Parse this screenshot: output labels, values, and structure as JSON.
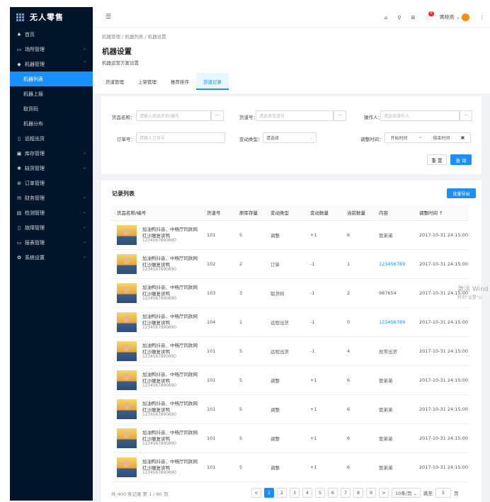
{
  "brand": "无人零售",
  "sidebar": {
    "items": [
      {
        "label": "首页",
        "icon": "home-icon",
        "glyph": "♠",
        "arrow": ""
      },
      {
        "label": "场所管理",
        "icon": "store-icon",
        "glyph": "▭",
        "arrow": "⌄"
      },
      {
        "label": "机器管理",
        "icon": "machine-icon",
        "glyph": "◆",
        "arrow": "⌃"
      }
    ],
    "subitems": [
      "机器列表",
      "机器上报",
      "取货码",
      "机器分布"
    ],
    "items2": [
      {
        "label": "远程出货",
        "icon": "remote-icon",
        "glyph": "▯",
        "arrow": ""
      },
      {
        "label": "库存管理",
        "icon": "stock-icon",
        "glyph": "▣",
        "arrow": "⌄"
      },
      {
        "label": "缺货管理",
        "icon": "shortage-icon",
        "glyph": "✱",
        "arrow": "⌄"
      },
      {
        "label": "订单管理",
        "icon": "order-icon",
        "glyph": "⊛",
        "arrow": ""
      },
      {
        "label": "财务管理",
        "icon": "finance-icon",
        "glyph": "✉",
        "arrow": "⌄"
      },
      {
        "label": "检测管理",
        "icon": "check-icon",
        "glyph": "▤",
        "arrow": "⌄"
      },
      {
        "label": "故障管理",
        "icon": "fault-icon",
        "glyph": "▯",
        "arrow": "⌄"
      },
      {
        "label": "报表管理",
        "icon": "report-icon",
        "glyph": "▭",
        "arrow": "⌄"
      },
      {
        "label": "系统设置",
        "icon": "settings-icon",
        "glyph": "✿",
        "arrow": "⌄"
      }
    ]
  },
  "topbar": {
    "fold": "☰",
    "user": "黄晓燕",
    "badge": "6"
  },
  "page": {
    "breadcrumb": "机器管理 / 机器列表 / 机器设置",
    "title": "机器设置",
    "desc": "机器运营方案设置",
    "tabs": [
      "货道管理",
      "上架管理",
      "推荐排序",
      "货道记录"
    ]
  },
  "filter": {
    "name_label": "货品名称：",
    "name_ph": "请输入商品名称/编号",
    "lane_label": "货道号：",
    "lane_ph": "请选择货道号",
    "op_label": "操作人：",
    "op_ph": "请选择操作人",
    "order_label": "订单号：",
    "order_ph": "请输入订单号",
    "type_label": "变动类型：",
    "type_val": "请选择",
    "time_label": "调整时间：",
    "start": "开始时间",
    "end": "结束时间",
    "sep": "~",
    "dots": "···",
    "reset": "重 置",
    "search": "查 询"
  },
  "records": {
    "title": "记录列表",
    "export": "批量导出",
    "columns": [
      "货品名称/编号",
      "货道号",
      "原库存量",
      "变动类型",
      "变动数量",
      "当前数量",
      "内容",
      "调整时间 ↑"
    ],
    "rows": [
      {
        "name": "加油鸭抖音、中畅厅同款网红沙雕复读鸭",
        "code": "1234567890890",
        "lane": "101",
        "orig": "5",
        "type": "调整",
        "delta": "+1",
        "cur": "6",
        "content": "管弟弟",
        "link": false,
        "time": "2017-10-31  24:15:00"
      },
      {
        "name": "加油鸭抖音、中畅厅同款网红沙雕复读鸭",
        "code": "1234567890890",
        "lane": "102",
        "orig": "2",
        "type": "订单",
        "delta": "-1",
        "cur": "1",
        "content": "123456789",
        "link": true,
        "time": "2017-10-31  24:15:00"
      },
      {
        "name": "加油鸭抖音、中畅厅同款网红沙雕复读鸭",
        "code": "1234567890890",
        "lane": "103",
        "orig": "3",
        "type": "取货码",
        "delta": "-1",
        "cur": "2",
        "content": "987654",
        "link": false,
        "time": "2017-10-31  24:15:00"
      },
      {
        "name": "加油鸭抖音、中畅厅同款网红沙雕复读鸭",
        "code": "1234567890890",
        "lane": "104",
        "orig": "1",
        "type": "远程出货",
        "delta": "-1",
        "cur": "0",
        "content": "123456789",
        "link": true,
        "time": "2017-10-31  24:15:00"
      },
      {
        "name": "加油鸭抖音、中畅厅同款网红沙雕复读鸭",
        "code": "1234567890890",
        "lane": "101",
        "orig": "5",
        "type": "远程出货",
        "delta": "-1",
        "cur": "4",
        "content": "异常出货",
        "link": false,
        "time": "2017-10-31  24:15:00"
      },
      {
        "name": "加油鸭抖音、中畅厅同款网红沙雕复读鸭",
        "code": "1234567890890",
        "lane": "101",
        "orig": "5",
        "type": "调整",
        "delta": "+1",
        "cur": "6",
        "content": "管弟弟",
        "link": false,
        "time": "2017-10-31  24:15:00"
      },
      {
        "name": "加油鸭抖音、中畅厅同款网红沙雕复读鸭",
        "code": "1234567890890",
        "lane": "101",
        "orig": "5",
        "type": "调整",
        "delta": "+1",
        "cur": "6",
        "content": "管弟弟",
        "link": false,
        "time": "2017-10-31  24:15:00"
      },
      {
        "name": "加油鸭抖音、中畅厅同款网红沙雕复读鸭",
        "code": "1234567890890",
        "lane": "101",
        "orig": "5",
        "type": "调整",
        "delta": "+1",
        "cur": "6",
        "content": "管弟弟",
        "link": false,
        "time": "2017-10-31  24:15:00"
      },
      {
        "name": "加油鸭抖音、中畅厅同款网红沙雕复读鸭",
        "code": "1234567890890",
        "lane": "101",
        "orig": "5",
        "type": "调整",
        "delta": "+1",
        "cur": "6",
        "content": "管弟弟",
        "link": false,
        "time": "2017-10-31  24:15:00"
      }
    ],
    "footer": "共 400 条记录 第 1 / 80 页",
    "pages": [
      "1",
      "2",
      "3",
      "4",
      "5",
      "6",
      "7",
      "8",
      "9"
    ],
    "prev": "<",
    "next": ">",
    "pagesize": "10条/页 ⌄",
    "goto_label": "跳至",
    "goto_val": "5",
    "goto_unit": "页"
  },
  "watermark": {
    "line1": "激活 Wind",
    "line2": "转到\"设置\"以"
  }
}
